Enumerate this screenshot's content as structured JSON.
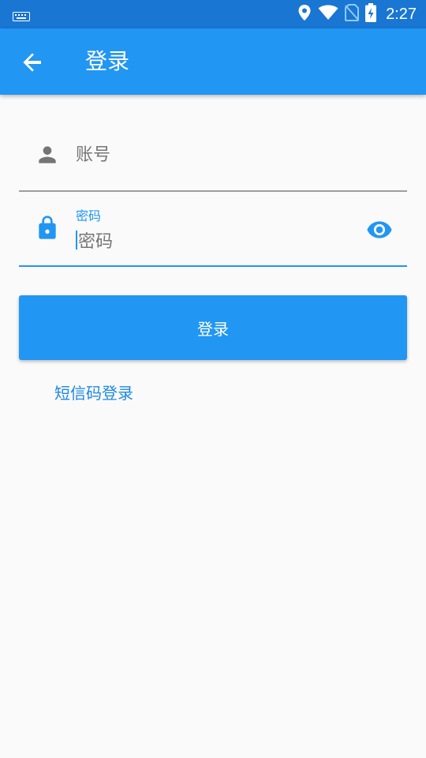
{
  "status_bar": {
    "time": "2:27",
    "icons": [
      "keyboard-icon",
      "location-icon",
      "wifi-icon",
      "no-sim-icon",
      "battery-charging-icon"
    ]
  },
  "app_bar": {
    "title": "登录",
    "back_icon": "arrow-back-icon"
  },
  "form": {
    "account": {
      "placeholder": "账号",
      "icon": "person-icon"
    },
    "password": {
      "floating_label": "密码",
      "placeholder": "密码",
      "icon": "lock-icon",
      "toggle_icon": "eye-icon"
    }
  },
  "login_button": "登录",
  "sms_login_link": "短信码登录",
  "colors": {
    "status_bar": "#1976d2",
    "primary": "#2196f3",
    "background": "#fafafa",
    "icon_gray": "#757575",
    "link": "#1e88e5"
  }
}
